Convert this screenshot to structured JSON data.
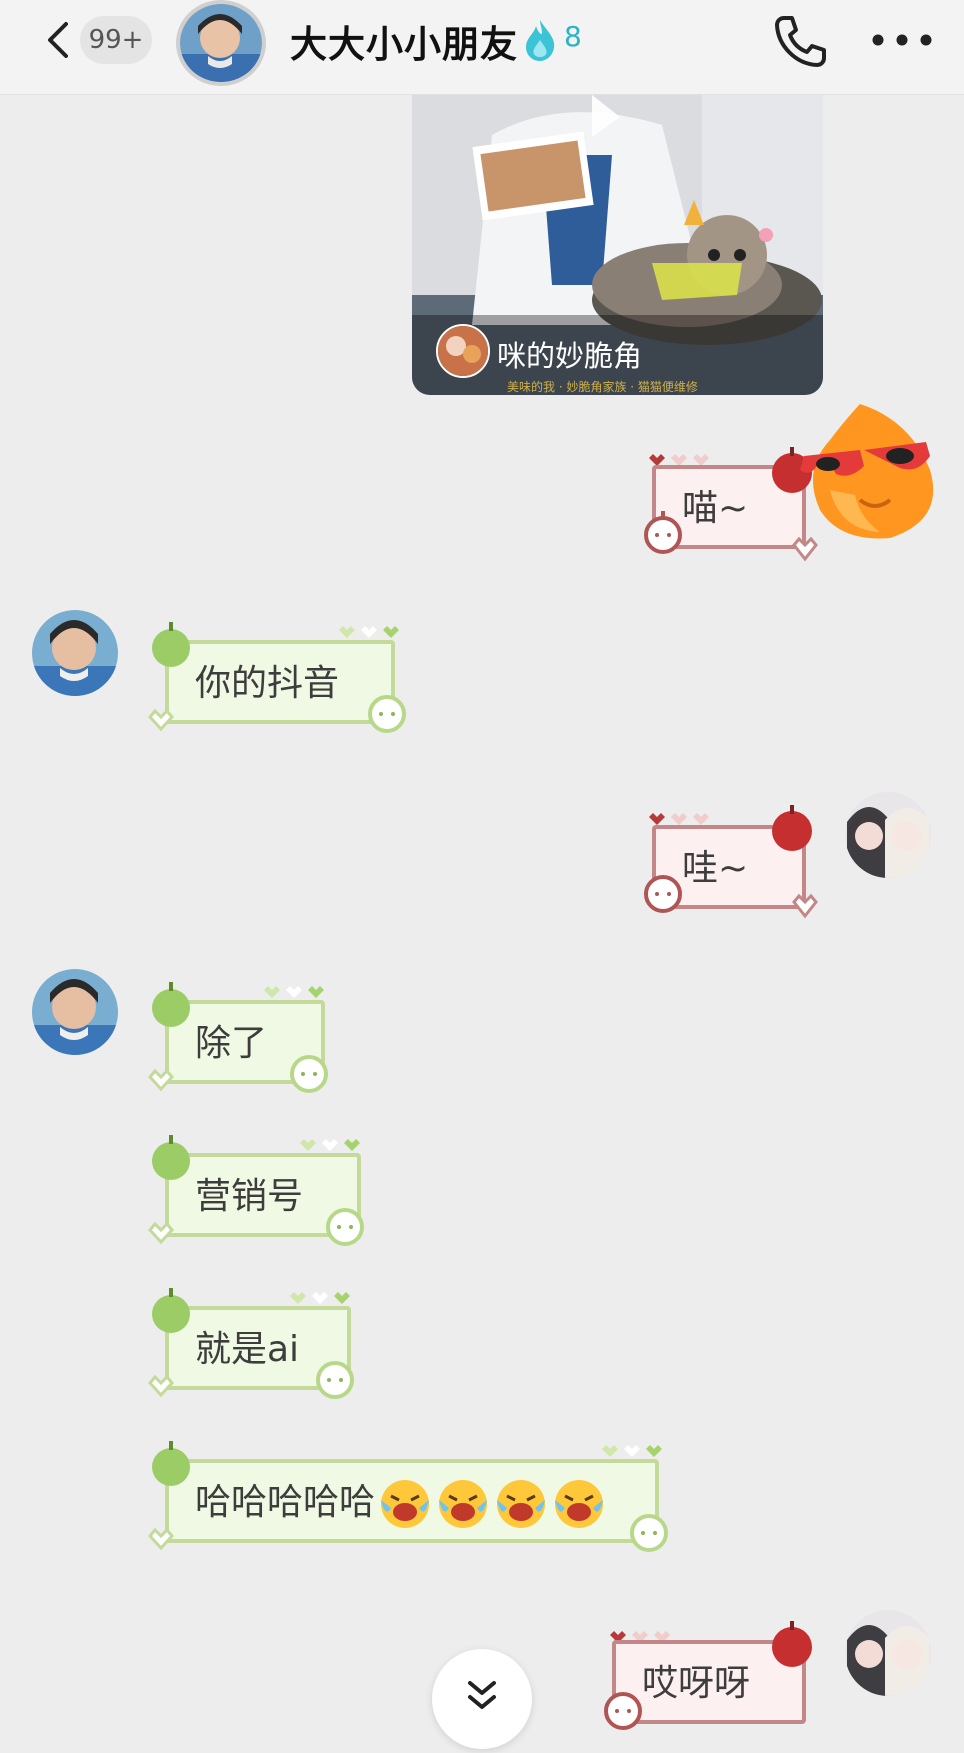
{
  "header": {
    "unread_count": "99+",
    "title": "大大小小朋友",
    "streak": "8"
  },
  "media_card": {
    "caption": "咪的妙脆角",
    "subcaption": "美味的我 · 妙脆角家族 · 猫猫便维修"
  },
  "messages": [
    {
      "side": "right",
      "text": "喵~"
    },
    {
      "side": "left",
      "text": "你的抖音"
    },
    {
      "side": "right",
      "text": "哇~"
    },
    {
      "side": "left",
      "text": "除了"
    },
    {
      "side": "left",
      "text": "营销号"
    },
    {
      "side": "left",
      "text": "就是ai"
    },
    {
      "side": "left",
      "text": "哈哈哈哈哈",
      "emojis": 4
    },
    {
      "side": "right",
      "text": "哎呀呀"
    }
  ],
  "colors": {
    "green_bubble": "#f0f9e3",
    "green_border": "#c3da9a",
    "pink_bubble": "#fdf0f0",
    "pink_border": "#c48787",
    "streak": "#2bb3c8"
  },
  "icons": [
    "back-icon",
    "flame-icon",
    "phone-icon",
    "more-icon",
    "apple-icon",
    "heart-icon",
    "chevron-down-icon",
    "laugh-cry-emoji"
  ]
}
